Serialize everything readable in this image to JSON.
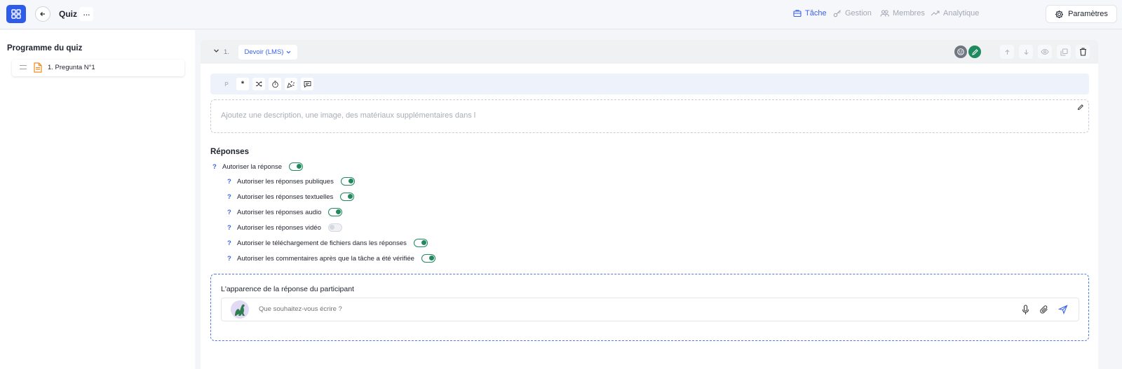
{
  "topbar": {
    "title": "Quiz",
    "more_label": "···",
    "tabs": [
      {
        "label": "Tâche",
        "icon": "briefcase-icon",
        "active": true
      },
      {
        "label": "Gestion",
        "icon": "key-icon",
        "active": false
      },
      {
        "label": "Membres",
        "icon": "users-icon",
        "active": false
      },
      {
        "label": "Analytique",
        "icon": "trend-icon",
        "active": false
      }
    ],
    "settings_label": "Paramètres"
  },
  "sidebar": {
    "title": "Programme du quiz",
    "items": [
      {
        "label": "1. Pregunta N°1",
        "icon": "document-icon"
      }
    ]
  },
  "question": {
    "number": "1.",
    "type_label": "Devoir (LMS)",
    "description_placeholder": "Ajoutez une description, une image, des matériaux supplémentaires dans l",
    "responses_title": "Réponses",
    "settings": [
      {
        "label": "Autoriser la réponse",
        "help": "?",
        "enabled": true
      },
      {
        "label": "Autoriser les réponses publiques",
        "help": "?",
        "enabled": true
      },
      {
        "label": "Autoriser les réponses textuelles",
        "help": "?",
        "enabled": true
      },
      {
        "label": "Autoriser les réponses audio",
        "help": "?",
        "enabled": true
      },
      {
        "label": "Autoriser les réponses vidéo",
        "help": "?",
        "enabled": false
      },
      {
        "label": "Autoriser le téléchargement de fichiers dans les réponses",
        "help": "?",
        "enabled": true
      },
      {
        "label": "Autoriser les commentaires après que la tâche a été vérifiée",
        "help": "?",
        "enabled": true
      }
    ],
    "appearance_title": "L'apparence de la réponse du participant",
    "composer_placeholder": "Que souhaitez-vous écrire ?"
  },
  "colors": {
    "accent": "#3a63e8",
    "brand": "#2f5bea",
    "toggle_on": "#1e8a5e"
  }
}
